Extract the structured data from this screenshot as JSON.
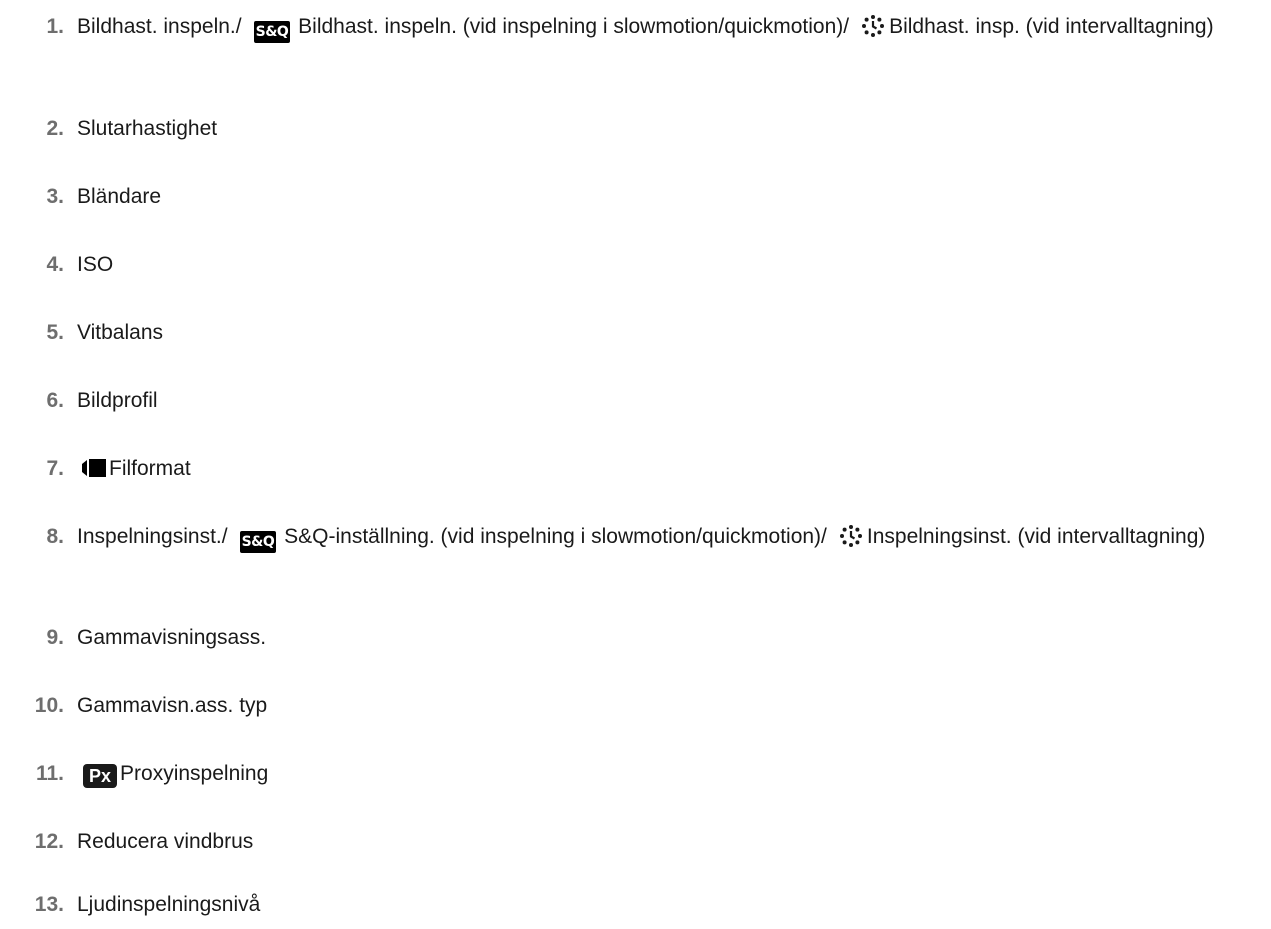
{
  "items": [
    {
      "number": "1.",
      "part1": "Bildhast. inspeln./",
      "sq_icon_text": "S&Q",
      "part2": "Bildhast. inspeln. (vid inspelning i slowmotion/quickmotion)/",
      "part3": "Bildhast. insp. (vid intervalltagning)"
    },
    {
      "number": "2.",
      "text": "Slutarhastighet"
    },
    {
      "number": "3.",
      "text": "Bländare"
    },
    {
      "number": "4.",
      "text": "ISO"
    },
    {
      "number": "5.",
      "text": "Vitbalans"
    },
    {
      "number": "6.",
      "text": "Bildprofil"
    },
    {
      "number": "7.",
      "text": "Filformat",
      "icon": "movie-icon"
    },
    {
      "number": "8.",
      "part1": "Inspelningsinst./",
      "sq_icon_text": "S&Q",
      "part2": "S&Q-inställning. (vid inspelning i slowmotion/quickmotion)/",
      "part3": "Inspelningsinst. (vid intervalltagning)"
    },
    {
      "number": "9.",
      "text": "Gammavisningsass."
    },
    {
      "number": "10.",
      "text": "Gammavisn.ass. typ"
    },
    {
      "number": "11.",
      "text": "Proxyinspelning",
      "icon_text": "Px"
    },
    {
      "number": "12.",
      "text": "Reducera vindbrus"
    },
    {
      "number": "13.",
      "text": "Ljudinspelningsnivå"
    }
  ],
  "colors": {
    "number": "#6e6e6e",
    "text": "#1a1a1a",
    "icon_bg": "#000000"
  }
}
